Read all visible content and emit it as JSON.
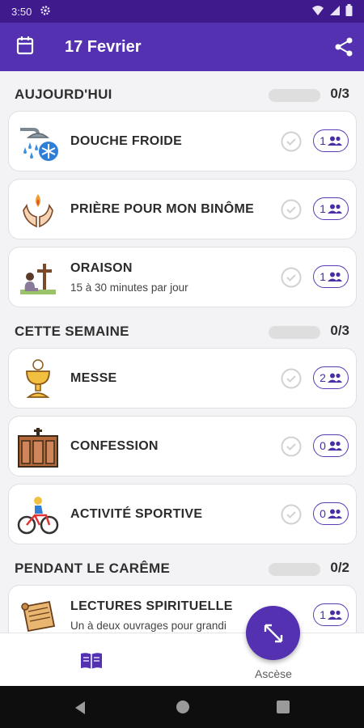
{
  "status_bar": {
    "time": "3:50"
  },
  "app_bar": {
    "title": "17 Fevrier"
  },
  "sections": [
    {
      "title": "AUJOURD'HUI",
      "count": "0/3"
    },
    {
      "title": "CETTE SEMAINE",
      "count": "0/3"
    },
    {
      "title": "PENDANT LE CARÊME",
      "count": "0/2"
    }
  ],
  "items": [
    {
      "name": "DOUCHE FROIDE",
      "subtitle": "",
      "participants": "1",
      "icon": "cold-shower-icon"
    },
    {
      "name": "PRIÈRE POUR MON BINÔME",
      "subtitle": "",
      "participants": "1",
      "icon": "praying-hands-icon"
    },
    {
      "name": "ORAISON",
      "subtitle": "15 à 30 minutes par jour",
      "participants": "1",
      "icon": "kneeling-prayer-icon"
    },
    {
      "name": "MESSE",
      "subtitle": "",
      "participants": "2",
      "icon": "chalice-icon"
    },
    {
      "name": "CONFESSION",
      "subtitle": "",
      "participants": "0",
      "icon": "confessional-icon"
    },
    {
      "name": "ACTIVITÉ SPORTIVE",
      "subtitle": "",
      "participants": "0",
      "icon": "cyclist-icon"
    },
    {
      "name": "LECTURES SPIRITUELLE",
      "subtitle": "Un à deux ouvrages pour grandi",
      "participants": "1",
      "icon": "scroll-icon"
    }
  ],
  "bottom_nav": {
    "asc_label": "Ascèse",
    "left_icon": "book-icon"
  },
  "colors": {
    "primary": "#5331b0",
    "status_bar": "#3f1a8c",
    "background": "#f3f3f5"
  }
}
